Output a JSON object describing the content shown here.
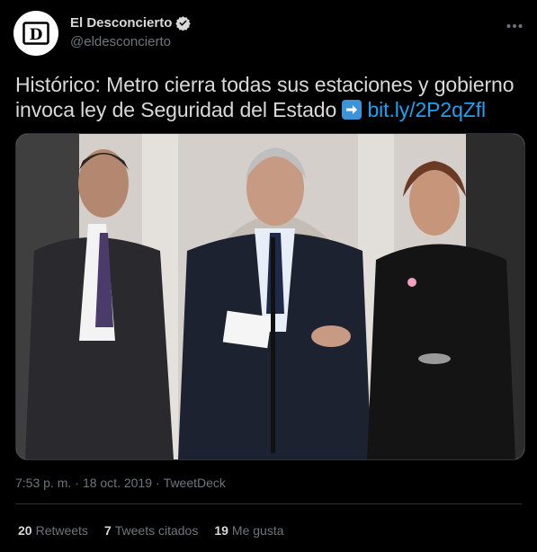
{
  "author": {
    "display_name": "El Desconcierto",
    "handle": "@eldesconcierto",
    "avatar_letter": "D",
    "verified_icon": "verified-badge-icon"
  },
  "tweet": {
    "text_before_link": "Histórico: Metro cierra todas sus estaciones y gobierno invoca ley de Seguridad del Estado",
    "emoji": "arrow-right-emoji",
    "link_text": "bit.ly/2P2qZfl",
    "media_alt": "photo"
  },
  "meta": {
    "time": "7:53 p. m.",
    "separator": "·",
    "date": "18 oct. 2019",
    "source": "TweetDeck"
  },
  "stats": {
    "retweets_count": "20",
    "retweets_label": "Retweets",
    "quotes_count": "7",
    "quotes_label": "Tweets citados",
    "likes_count": "19",
    "likes_label": "Me gusta"
  },
  "colors": {
    "background": "#000000",
    "text": "#d9d9d9",
    "secondary": "#6e767d",
    "link": "#1da1f2",
    "border": "#2f3336"
  }
}
